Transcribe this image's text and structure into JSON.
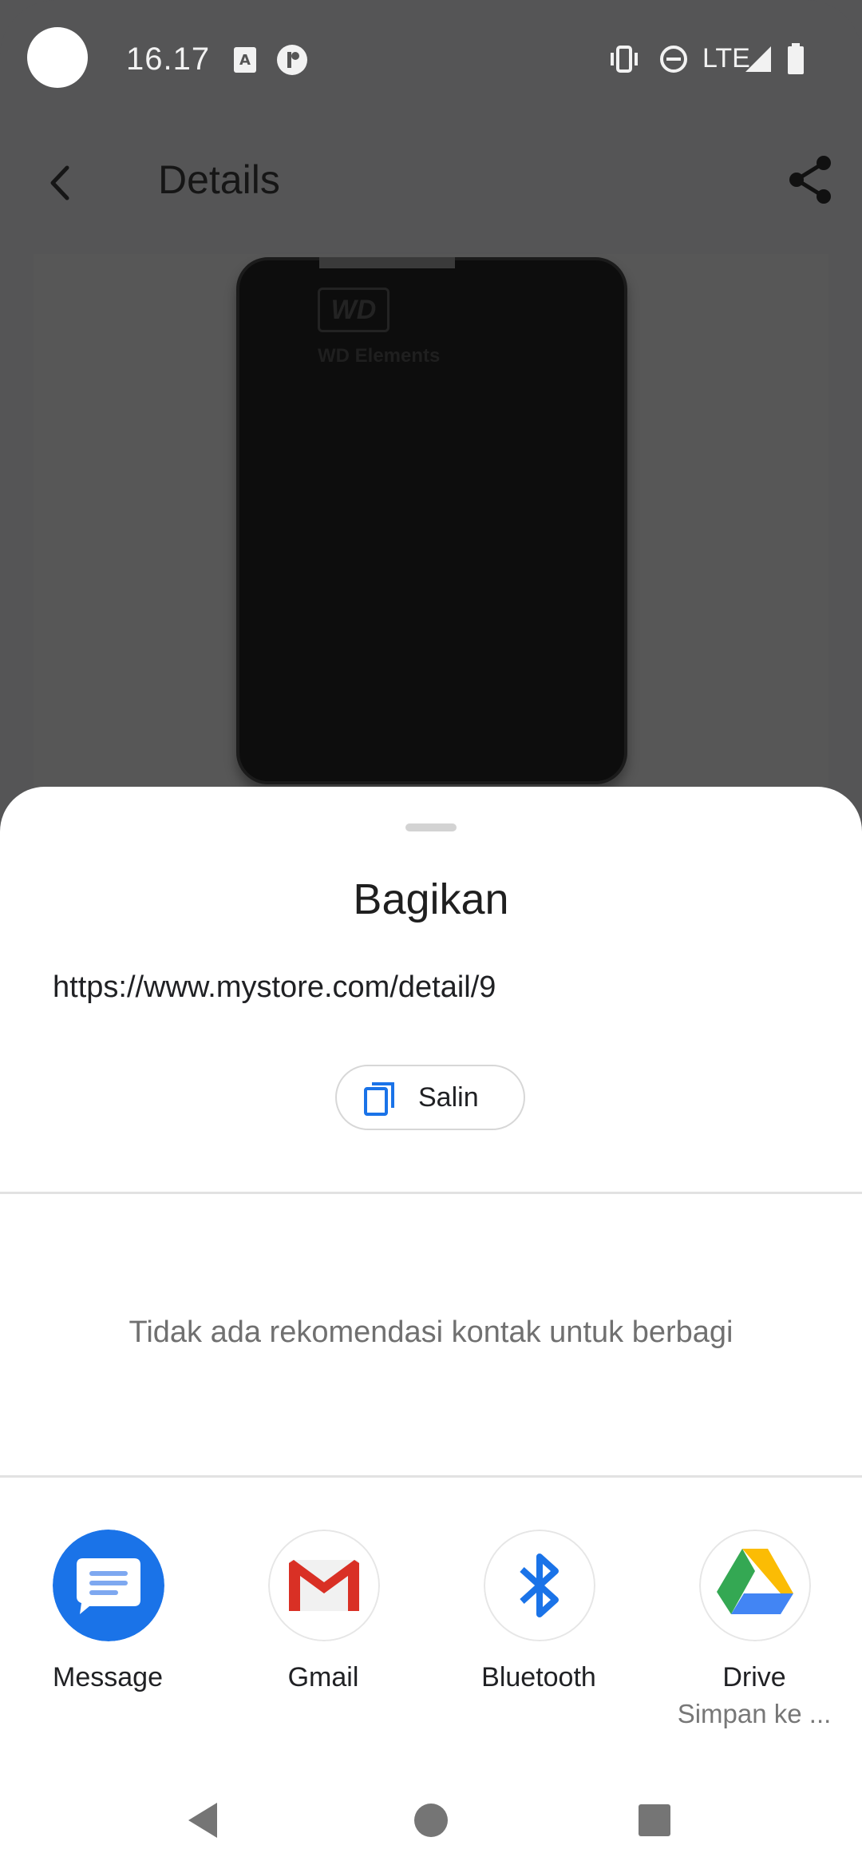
{
  "status_bar": {
    "time": "16.17",
    "network": "LTE",
    "icons": [
      "camera-cutout",
      "keyboard-notification-icon",
      "app-notification-icon",
      "vibrate-icon",
      "do-not-disturb-icon",
      "signal-icon",
      "battery-icon"
    ]
  },
  "app_bar": {
    "title": "Details",
    "back_icon": "back-arrow-icon",
    "share_icon": "share-icon"
  },
  "product": {
    "brand_logo": "WD",
    "brand_name": "WD Elements"
  },
  "share_sheet": {
    "title": "Bagikan",
    "url": "https://www.mystore.com/detail/9",
    "copy_label": "Salin",
    "no_contacts_text": "Tidak ada rekomendasi kontak untuk berbagi",
    "apps": [
      {
        "label": "Message",
        "subtitle": "",
        "icon": "message-icon",
        "color": "#1a73e8"
      },
      {
        "label": "Gmail",
        "subtitle": "",
        "icon": "gmail-icon",
        "color": "#d93025"
      },
      {
        "label": "Bluetooth",
        "subtitle": "",
        "icon": "bluetooth-icon",
        "color": "#1a73e8"
      },
      {
        "label": "Drive",
        "subtitle": "Simpan ke ...",
        "icon": "drive-icon",
        "color": "#34a853"
      }
    ]
  },
  "nav_bar": {
    "back": "nav-back-icon",
    "home": "nav-home-icon",
    "recents": "nav-recents-icon"
  },
  "colors": {
    "scrim": "#555556",
    "sheet_bg": "#ffffff",
    "accent_blue": "#1a73e8"
  }
}
